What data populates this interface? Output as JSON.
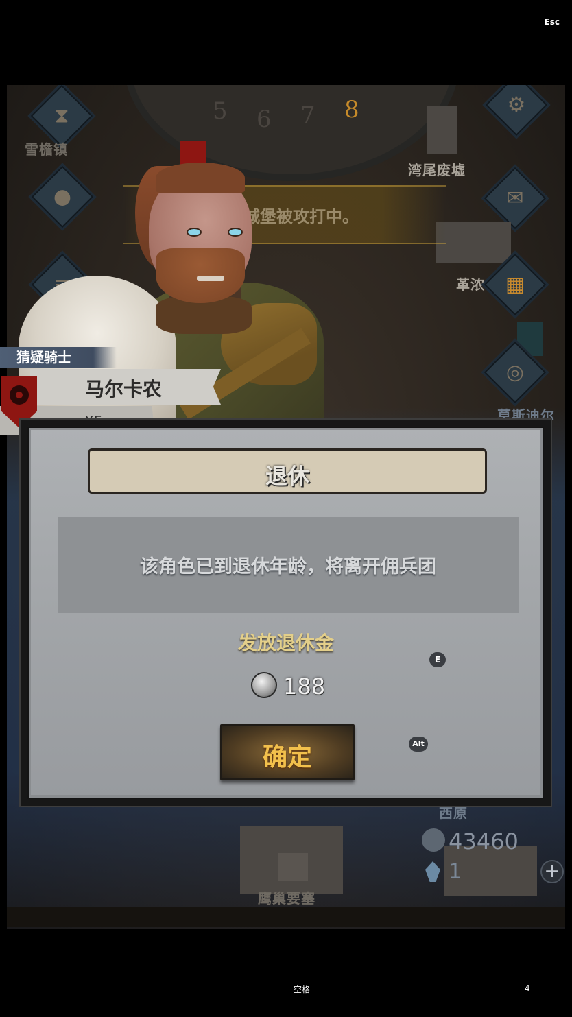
{
  "top_bar": {
    "esc_label": "Esc"
  },
  "map": {
    "dial_numbers": [
      "5",
      "6",
      "7",
      "8"
    ],
    "active_day": "8",
    "locations": {
      "snow_town": "雪檐镇",
      "bay_ruins": "湾尾废墟",
      "leather_town": "革浓",
      "southwest": "莫斯迪尔",
      "west_plains": "西原",
      "eagle_fortress": "鹰巢要塞"
    },
    "alert_message": "城堡被攻打中。",
    "currency": {
      "silver": "43460",
      "crystal": "1"
    },
    "add_icon": "+"
  },
  "character": {
    "class_name": "猜疑骑士",
    "name": "马尔卡农",
    "tag": "XF",
    "crest_color": "#8e1612"
  },
  "dialog": {
    "title": "退休",
    "message": "该角色已到退休年龄，将离开佣兵团",
    "pension_label": "发放退休金",
    "pension_amount": "188",
    "confirm_label": "确定",
    "key_hints": {
      "pension": "E",
      "confirm": "Alt"
    }
  },
  "footer": {
    "space_label": "空格",
    "page_num": "4"
  },
  "colors": {
    "accent_gold": "#f2c04c",
    "pension_gold": "#e3cf8a",
    "dialog_bg": "#a4a7aa"
  }
}
